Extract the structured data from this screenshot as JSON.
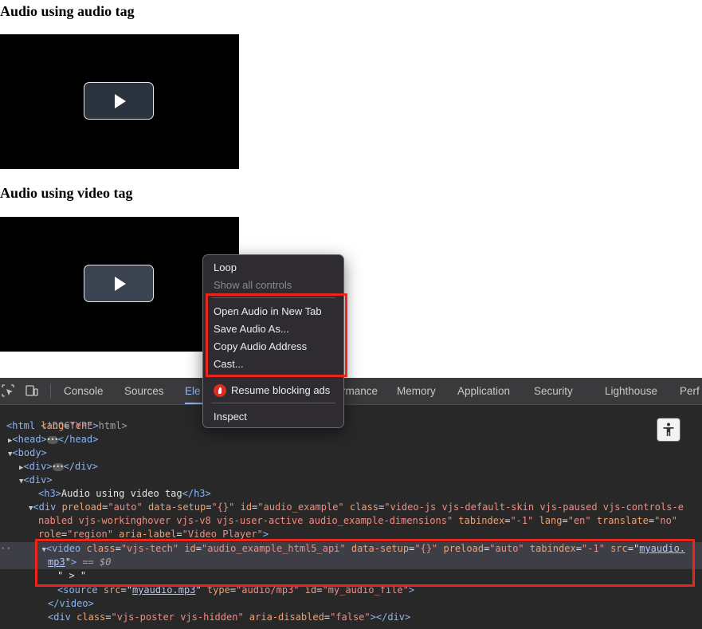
{
  "page": {
    "heading_audio_tag": "Audio using audio tag",
    "heading_video_tag": "Audio using video tag"
  },
  "devtools": {
    "tabs": [
      "Console",
      "Sources",
      "Ele",
      "rmance",
      "Memory",
      "Application",
      "Security",
      "Lighthouse",
      "Perf"
    ],
    "active_tab_index": 2,
    "icons": [
      "inspect-element-icon",
      "device-toolbar-icon",
      "accessibility-icon"
    ],
    "dom": {
      "doctype": "<!DOCTYPE html>",
      "html_tag": "html",
      "lang_attr": "lang",
      "lang_val": "\"en\"",
      "head_open": "<head>",
      "head_close": "</head>",
      "body_open": "<body>",
      "div_open": "<div>",
      "div_close": "</div>",
      "h3_open": "<h3>",
      "h3_text": "Audio using video tag",
      "h3_close": "</h3>",
      "div2_tag": "<div",
      "preload_attr": "preload",
      "preload_val": "\"auto\"",
      "datasetup_attr": "data-setup",
      "datasetup_val": "\"{}\"",
      "id_attr": "id",
      "id_val": "\"audio_example\"",
      "class_attr": "class",
      "class_val_a": "\"video-js vjs-default-skin vjs-paused vjs-controls-e",
      "class_val_b": "nabled vjs-workinghover vjs-v8 vjs-user-active audio_example-dimensions\"",
      "tabindex_attr": "tabindex",
      "tabindex_val": "\"-1\"",
      "translate_attr": "translate",
      "translate_val": "\"no\"",
      "role_attr": "role",
      "role_val": "\"region\"",
      "arialabel_attr": "aria-label",
      "arialabel_val": "\"Video Player\"",
      "video_tag": "<video",
      "vclass_val": "\"vjs-tech\"",
      "vid_val": "\"audio_example_html5_api\"",
      "src_attr": "src",
      "src_link_a": "myaudio.",
      "src_link_b": "mp3",
      "eq_sel": "== $0",
      "text_node": "\" > \"",
      "source_tag": "<source",
      "source_src": "myaudio.mp3",
      "type_attr": "type",
      "type_val": "\"audio/mp3\"",
      "source_id_val": "\"my_audio_file\"",
      "video_close": "</video>",
      "poster_tag": "<div",
      "poster_class_val": "\"vjs-poster vjs-hidden\"",
      "ariadisabled_attr": "aria-disabled",
      "ariadisabled_val": "\"false\"",
      "poster_close": "></div>"
    }
  },
  "context_menu": {
    "loop": "Loop",
    "show_all_controls": "Show all controls",
    "open_new_tab": "Open Audio in New Tab",
    "save_as": "Save Audio As...",
    "copy_address": "Copy Audio Address",
    "cast": "Cast...",
    "resume_blocking": "Resume blocking ads",
    "inspect": "Inspect"
  },
  "colors": {
    "highlight_box": "#e8261a",
    "devtools_bg": "#282828",
    "menu_bg": "#2e2c31"
  }
}
